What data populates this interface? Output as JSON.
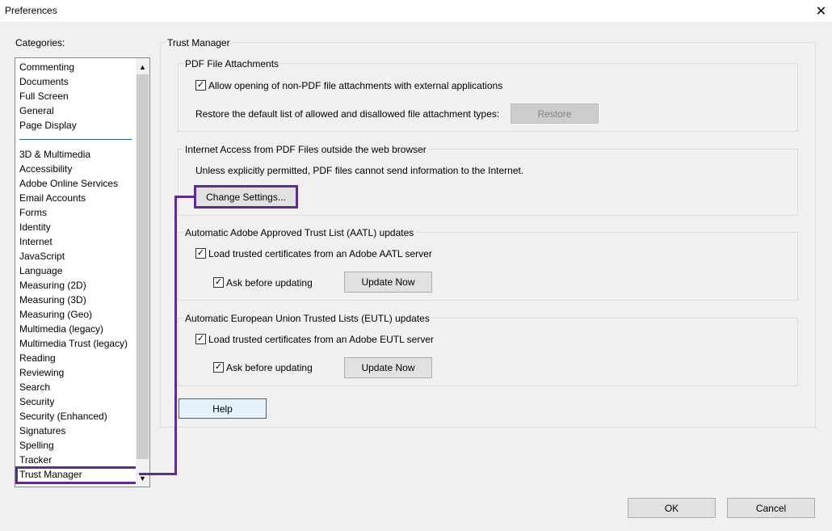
{
  "window": {
    "title": "Preferences"
  },
  "categories": {
    "label": "Categories:",
    "items": [
      "Commenting",
      "Documents",
      "Full Screen",
      "General",
      "Page Display",
      "3D & Multimedia",
      "Accessibility",
      "Adobe Online Services",
      "Email Accounts",
      "Forms",
      "Identity",
      "Internet",
      "JavaScript",
      "Language",
      "Measuring (2D)",
      "Measuring (3D)",
      "Measuring (Geo)",
      "Multimedia (legacy)",
      "Multimedia Trust (legacy)",
      "Reading",
      "Reviewing",
      "Search",
      "Security",
      "Security (Enhanced)",
      "Signatures",
      "Spelling",
      "Tracker",
      "Trust Manager"
    ],
    "selected": "Trust Manager"
  },
  "trust_manager": {
    "title": "Trust Manager",
    "pdf_attachments": {
      "title": "PDF File Attachments",
      "allow_label": "Allow opening of non-PDF file attachments with external applications",
      "allow_checked": true,
      "restore_text": "Restore the default list of allowed and disallowed file attachment types:",
      "restore_button": "Restore"
    },
    "internet_access": {
      "title": "Internet Access from PDF Files outside the web browser",
      "description": "Unless explicitly permitted, PDF files cannot send information to the Internet.",
      "change_button": "Change Settings..."
    },
    "aatl": {
      "title": "Automatic Adobe Approved Trust List (AATL) updates",
      "load_label": "Load trusted certificates from an Adobe AATL server",
      "load_checked": true,
      "ask_label": "Ask before updating",
      "ask_checked": true,
      "update_button": "Update Now"
    },
    "eutl": {
      "title": "Automatic European Union Trusted Lists (EUTL) updates",
      "load_label": "Load trusted certificates from an Adobe EUTL server",
      "load_checked": true,
      "ask_label": "Ask before updating",
      "ask_checked": true,
      "update_button": "Update Now"
    },
    "help_button": "Help"
  },
  "footer": {
    "ok": "OK",
    "cancel": "Cancel"
  },
  "icons": {
    "close": "close-icon",
    "check": "check-icon",
    "scroll_up": "chevron-up-icon",
    "scroll_down": "chevron-down-icon"
  },
  "colors": {
    "highlight": "#5b2d8e",
    "background": "#f0f0f0"
  }
}
